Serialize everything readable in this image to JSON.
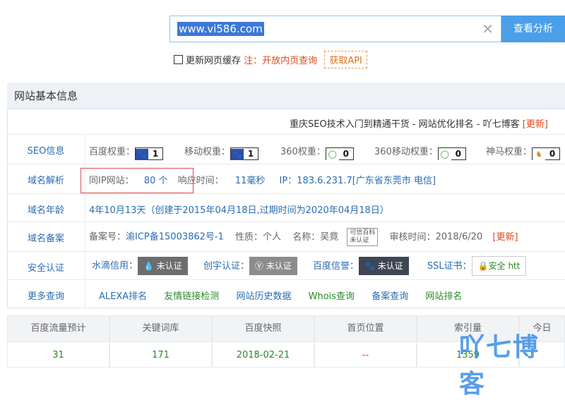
{
  "search": {
    "value": "www.vi586.com",
    "button": "查看分析"
  },
  "options": {
    "refresh_label": "更新网页缓存",
    "note_prefix": "注：",
    "note": "开放内页查询",
    "api_button": "获取API"
  },
  "panel": {
    "title": "网站基本信息",
    "subtitle": "重庆SEO技术入门到精通干货 - 网站优化排名 - 吖七博客",
    "update": "[更新]"
  },
  "seo": {
    "label": "SEO信息",
    "items": [
      {
        "name": "百度权重：",
        "value": "1"
      },
      {
        "name": "移动权重：",
        "value": "1"
      },
      {
        "name": "360权重：",
        "value": "0"
      },
      {
        "name": "360移动权重：",
        "value": "0"
      },
      {
        "name": "神马权重：",
        "value": "0"
      }
    ]
  },
  "dns": {
    "label": "域名解析",
    "same_ip_label": "同IP网站：",
    "same_ip_value": "80 个",
    "resp_label": "响应时间：",
    "resp_value": "11毫秒",
    "ip": "IP：183.6.231.7[广东省东莞市 电信]"
  },
  "age": {
    "label": "域名年龄",
    "value": "4年10月13天（创建于2015年04月18日,过期时间为2020年04月18日）"
  },
  "beian": {
    "label": "域名备案",
    "no_label": "备案号：",
    "no_value": "渝ICP备15003862号-1",
    "nature_label": "性质：",
    "nature_value": "个人",
    "name_label": "名称：",
    "name_value": "吴竟",
    "kexin": "可信百科",
    "kexin_sub": "未认证",
    "audit_label": "审核时间：",
    "audit_value": "2018/6/20",
    "update": "[更新]"
  },
  "security": {
    "label": "安全认证",
    "shuidi": "水滴信用：",
    "shuidi_badge": "未认证",
    "chuangyu": "创宇认证：",
    "chuangyu_badge": "未认证",
    "baidu": "百度信誉：",
    "baidu_badge": "未认证",
    "ssl": "SSL证书：",
    "ssl_badge": "安全 htt"
  },
  "more": {
    "label": "更多查询",
    "links": [
      "ALEXA排名",
      "友情链接检测",
      "网站历史数据",
      "Whois查询",
      "备案查询",
      "网站排名"
    ]
  },
  "stats": {
    "headers": [
      "百度流量预计",
      "关键词库",
      "百度快照",
      "首页位置",
      "索引量",
      "今日"
    ],
    "values": [
      "31",
      "171",
      "2018-02-21",
      "--",
      "1359",
      ""
    ]
  },
  "watermark": "吖七博客",
  "colors": {
    "accent": "#4a9fe8",
    "link": "#2a6db3",
    "red": "#e04a1a",
    "green": "#2a8a2a"
  }
}
